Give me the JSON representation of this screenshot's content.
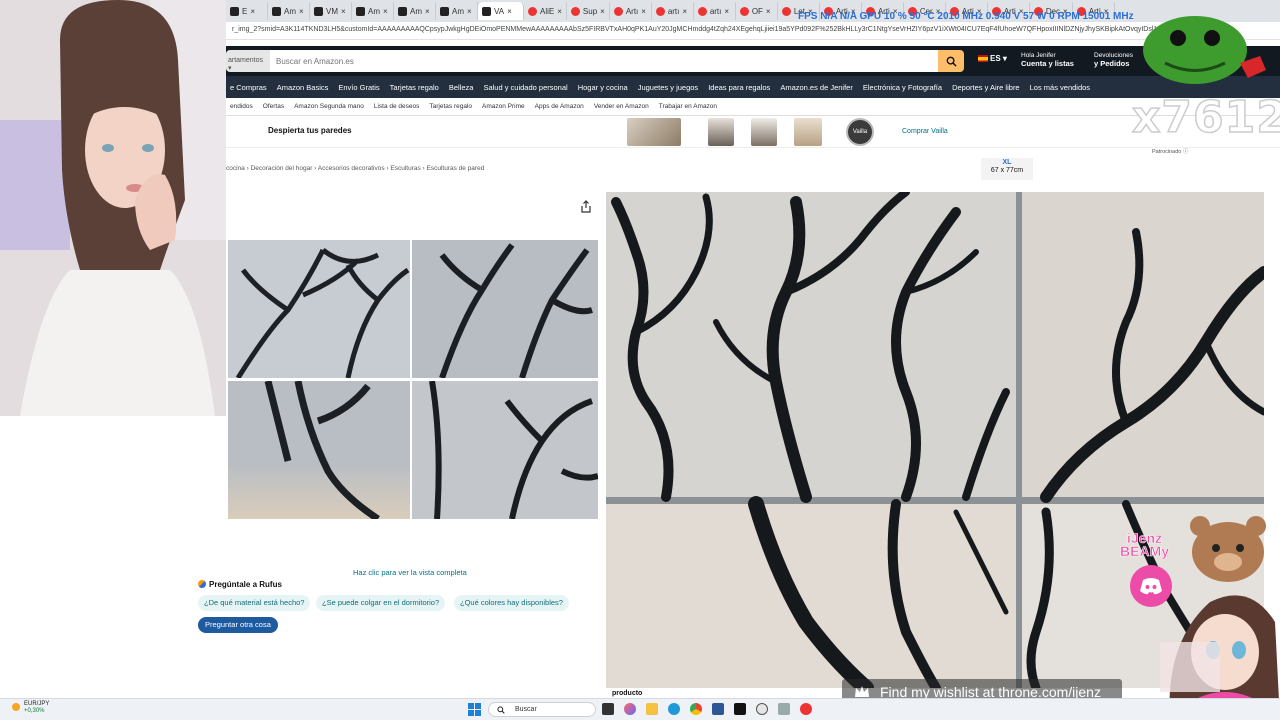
{
  "browser": {
    "tabs": [
      {
        "label": "E",
        "fav": "amz"
      },
      {
        "label": "Am",
        "fav": "amz"
      },
      {
        "label": "VM",
        "fav": "amz"
      },
      {
        "label": "Am",
        "fav": "amz"
      },
      {
        "label": "Am",
        "fav": "amz"
      },
      {
        "label": "Am",
        "fav": "amz"
      },
      {
        "label": "VA",
        "fav": "amz",
        "active": true
      },
      {
        "label": "AliE",
        "fav": "ali"
      },
      {
        "label": "Sup",
        "fav": "ali"
      },
      {
        "label": "Artı",
        "fav": "ali"
      },
      {
        "label": "artı",
        "fav": "ali"
      },
      {
        "label": "artı",
        "fav": "ali"
      },
      {
        "label": "OF",
        "fav": "ali"
      },
      {
        "label": "Let",
        "fav": "ali"
      },
      {
        "label": "Arti",
        "fav": "ali"
      },
      {
        "label": "Arti",
        "fav": "ali"
      },
      {
        "label": "Cer",
        "fav": "ali"
      },
      {
        "label": "Arti",
        "fav": "ali"
      },
      {
        "label": "Arti",
        "fav": "ali"
      },
      {
        "label": "Dec",
        "fav": "ali"
      },
      {
        "label": "Arti",
        "fav": "ali"
      }
    ],
    "overlay_stats": "FPS N/A N/A   GPU 10 % 50 °C 2010 MHz 0.940 V 57 W 0 RPM 15001 MHz",
    "url": "r_img_2?smid=A3K114TKND3LH5&customId=AAAAAAAAAQCpsypJwkgHgDEiOmoPENMMewAAAAAAAAAbSz5FIRBVTxAH0qPK1AuY20JgMCHmddg4tZqh24XEgehqLjiiei19a5YPd092F%252BkHLLy3rC1NtgYseVrHZIY6pzV1iXWt04ICU7EqF4fUhoeW7QFHpoxIIINlDZNjyJhySKBipkAtOvqyIDsl1AN9r1lu"
  },
  "amazon": {
    "dept_label": "artamentos",
    "search_placeholder": "Buscar en Amazon.es",
    "lang": "ES",
    "account_line1": "Hola Jenifer",
    "account_line2": "Cuenta y listas",
    "returns_line1": "Devoluciones",
    "returns_line2": "y Pedidos",
    "nav": [
      "e Compras",
      "Amazon Basics",
      "Envío Gratis",
      "Tarjetas regalo",
      "Belleza",
      "Salud y cuidado personal",
      "Hogar y cocina",
      "Juguetes y juegos",
      "Ideas para regalos",
      "Amazon.es de Jenifer",
      "Electrónica y Fotografía",
      "Deportes y Aire libre",
      "Los más vendidos"
    ],
    "subnav": [
      "endidos",
      "Ofertas",
      "Amazon Segunda mano",
      "Lista de deseos",
      "Tarjetas regalo",
      "Amazon Prime",
      "Apps de Amazon",
      "Vender en Amazon",
      "Trabajar en Amazon"
    ],
    "ad_title": "Despierta tus paredes",
    "ad_logo": "Vailla",
    "ad_cta": "Comprar Vailla",
    "sponsored": "Patrocinado",
    "xl_size": "XL",
    "xl_dims": "67 x 77cm",
    "breadcrumb": "cocina › Decoración del hogar › Accesorios decorativos › Esculturas › Esculturas de pared",
    "full_view": "Haz clic para ver la vista completa",
    "rufus_title": "Pregúntale a Rufus",
    "rufus_chips": [
      "¿De qué material está hecho?",
      "¿Se puede colgar en el dormitorio?",
      "¿Qué colores hay disponibles?"
    ],
    "ask_other": "Preguntar otra cosa",
    "product_label": "producto"
  },
  "stream": {
    "big_text": "x7612",
    "wishlist": "Find my wishlist at throne.com/ijenz",
    "jenz": "iJenz",
    "beamy": "BEAMy"
  },
  "taskbar": {
    "ticker_symbol": "EUR/JPY",
    "ticker_change": "+0,30%",
    "search_label": "Buscar"
  }
}
